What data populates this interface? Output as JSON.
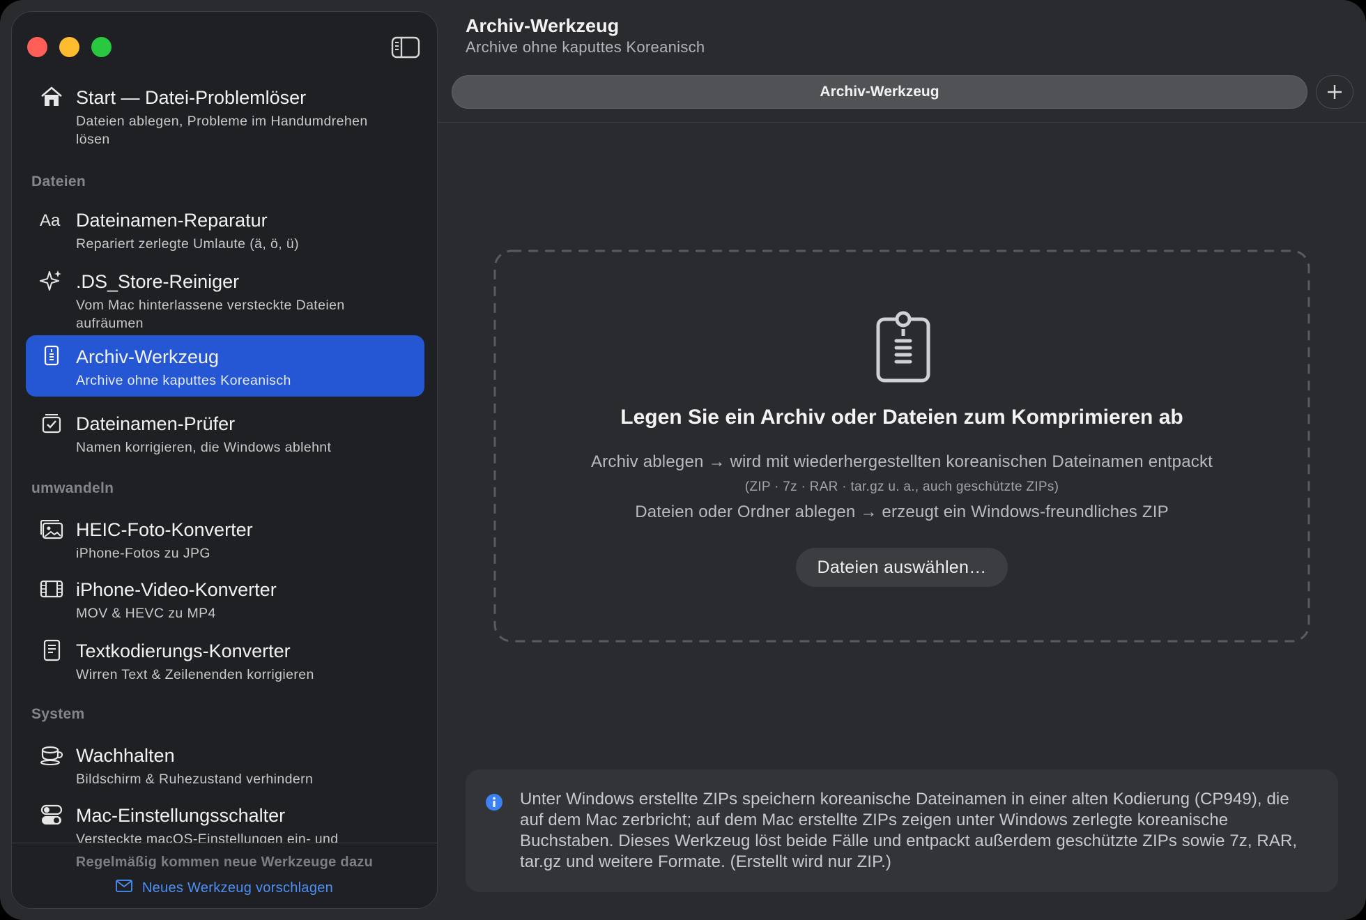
{
  "sidebar": {
    "items": [
      {
        "icon": "house-icon",
        "title": "Start — Datei-Problemlöser",
        "subtitle": "Dateien ablegen, Probleme im Handumdrehen lösen"
      },
      {
        "icon": "text-aa-icon",
        "title": "Dateinamen-Reparatur",
        "subtitle": "Repariert zerlegte Umlaute (ä, ö, ü)"
      },
      {
        "icon": "sparkles-icon",
        "title": ".DS_Store-Reiniger",
        "subtitle": "Vom Mac hinterlassene versteckte Dateien aufräumen"
      },
      {
        "icon": "zipper-document-icon",
        "title": "Archiv-Werkzeug",
        "subtitle": "Archive ohne kaputtes Koreanisch",
        "active": true
      },
      {
        "icon": "checkmark-tray-icon",
        "title": "Dateinamen-Prüfer",
        "subtitle": "Namen korrigieren, die Windows ablehnt"
      },
      {
        "icon": "photo-stack-icon",
        "title": "HEIC-Foto-Konverter",
        "subtitle": "iPhone-Fotos zu JPG"
      },
      {
        "icon": "film-icon",
        "title": "iPhone-Video-Konverter",
        "subtitle": "MOV & HEVC zu MP4"
      },
      {
        "icon": "document-text-icon",
        "title": "Textkodierungs-Konverter",
        "subtitle": "Wirren Text & Zeilenenden korrigieren"
      },
      {
        "icon": "coffee-cup-icon",
        "title": "Wachhalten",
        "subtitle": "Bildschirm & Ruhezustand verhindern"
      },
      {
        "icon": "toggles-icon",
        "title": "Mac-Einstellungsschalter",
        "subtitle": "Versteckte macOS-Einstellungen ein- und"
      }
    ],
    "sections": {
      "files": "Dateien",
      "convert": "umwandeln",
      "system": "System"
    },
    "footer": {
      "note": "Regelmäßig kommen neue Werkzeuge dazu",
      "link": "Neues Werkzeug vorschlagen"
    }
  },
  "main": {
    "title": "Archiv-Werkzeug",
    "subtitle": "Archive ohne kaputtes Koreanisch",
    "tab_label": "Archiv-Werkzeug",
    "dropzone": {
      "headline": "Legen Sie ein Archiv oder Dateien zum Komprimieren ab",
      "line1": "Archiv ablegen → wird mit wiederhergestellten koreanischen Dateinamen entpackt",
      "line2": "(ZIP · 7z · RAR · tar.gz u. a., auch geschützte ZIPs)",
      "line3": "Dateien oder Ordner ablegen → erzeugt ein Windows-freundliches ZIP",
      "button": "Dateien auswählen…"
    },
    "info": "Unter Windows erstellte ZIPs speichern koreanische Dateinamen in einer alten Kodierung (CP949), die auf dem Mac zerbricht; auf dem Mac erstellte ZIPs zeigen unter Windows zerlegte koreanische Buchstaben. Dieses Werkzeug löst beide Fälle und entpackt außerdem geschützte ZIPs sowie 7z, RAR, tar.gz und weitere Formate. (Erstellt wird nur ZIP.)"
  },
  "colors": {
    "accent": "#2556d4",
    "link": "#4b8ff7",
    "info_icon": "#3b82f6"
  }
}
